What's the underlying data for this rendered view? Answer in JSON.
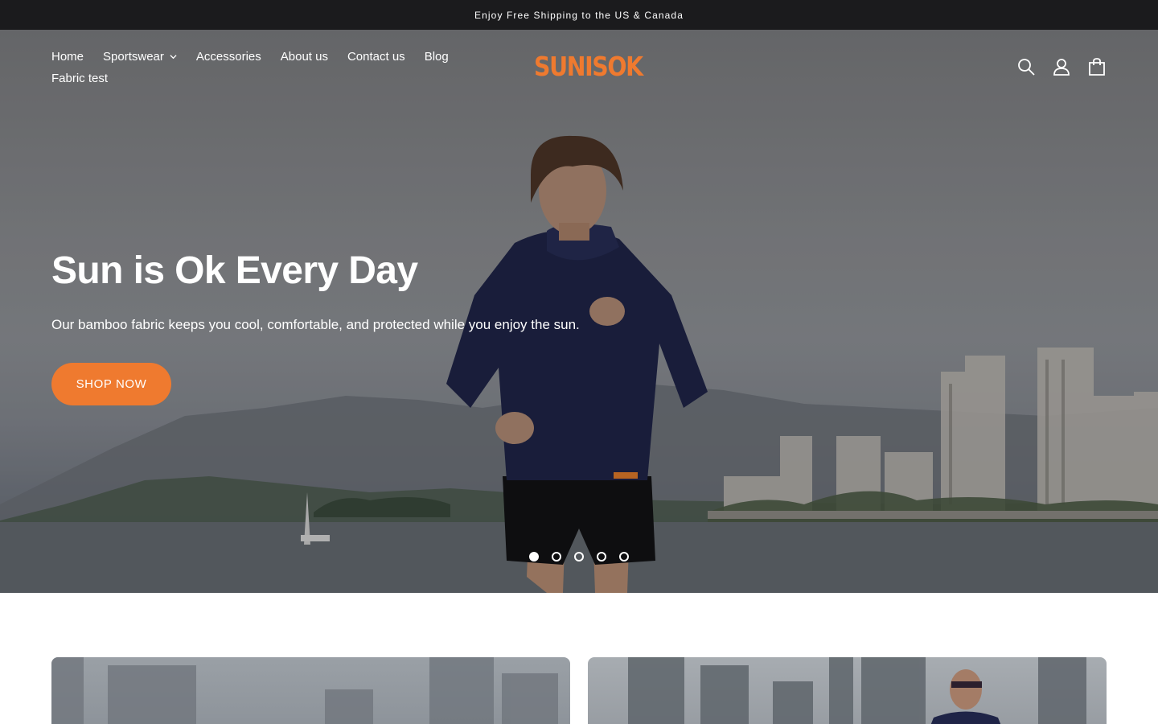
{
  "announcement": {
    "text": "Enjoy Free Shipping to the US & Canada"
  },
  "header": {
    "nav": [
      {
        "label": "Home"
      },
      {
        "label": "Sportswear",
        "has_dropdown": true
      },
      {
        "label": "Accessories"
      },
      {
        "label": "About us"
      },
      {
        "label": "Contact us"
      },
      {
        "label": "Blog"
      },
      {
        "label": "Fabric test"
      }
    ],
    "logo": "SUNISOK",
    "icons": [
      "search-icon",
      "account-icon",
      "cart-icon"
    ]
  },
  "hero": {
    "title": "Sun is Ok Every Day",
    "subtitle": "Our bamboo fabric keeps you cool, comfortable, and protected while you enjoy the sun.",
    "cta_label": "SHOP NOW",
    "slides_total": 5,
    "active_slide": 1
  },
  "colors": {
    "accent": "#ef7a2f",
    "announcement_bg": "#1b1b1d",
    "text_on_hero": "#ffffff"
  }
}
